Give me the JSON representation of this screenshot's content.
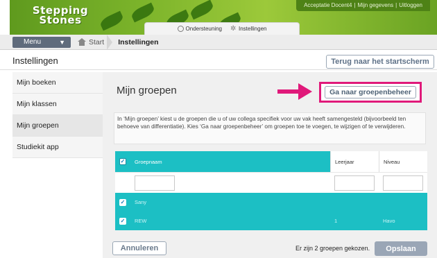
{
  "brand": {
    "line1": "Stepping",
    "line2": "Stones"
  },
  "top_links": [
    "Acceptatie Docent4",
    "Mijn gegevens",
    "Uitloggen"
  ],
  "subbar": {
    "support_label": "Ondersteuning",
    "settings_label": "Instellingen"
  },
  "nav": {
    "menu_label": "Menu",
    "start_label": "Start",
    "current_label": "Instellingen"
  },
  "header": {
    "title": "Instellingen",
    "back_button": "Terug naar het startscherm"
  },
  "sidebar": {
    "items": [
      {
        "label": "Mijn boeken"
      },
      {
        "label": "Mijn klassen"
      },
      {
        "label": "Mijn groepen"
      },
      {
        "label": "Studiekit app"
      }
    ]
  },
  "main": {
    "title": "Mijn groepen",
    "group_button": "Ga naar groepenbeheer",
    "info_text": "In ‘Mijn groepen’ kiest u de groepen die u of uw collega specifiek voor uw vak heeft samengesteld (bijvoorbeeld ten behoeve van differentiatie). Kies ‘Ga naar groepenbeheer’ om groepen toe te voegen, te wijzigen of te verwijderen."
  },
  "table": {
    "columns": {
      "name": "Groepnaam",
      "year": "Leerjaar",
      "level": "Niveau"
    },
    "rows": [
      {
        "name": "Sany",
        "year": "",
        "level": ""
      },
      {
        "name": "REW",
        "year": "1",
        "level": "Havo"
      }
    ]
  },
  "footer": {
    "cancel_label": "Annuleren",
    "status": "Er zijn 2 groepen gekozen.",
    "save_label": "Opslaan"
  },
  "colors": {
    "brand_green": "#7bb32a",
    "teal": "#1cbfc4",
    "highlight_magenta": "#e0197a",
    "nav_slate": "#5f6b7c"
  },
  "icons": {
    "support": "help-circle-icon",
    "settings": "gear-icon",
    "home": "home-icon",
    "menu_chevron": "chevron-down-icon",
    "arrow": "arrow-right-icon",
    "check": "check-icon"
  }
}
